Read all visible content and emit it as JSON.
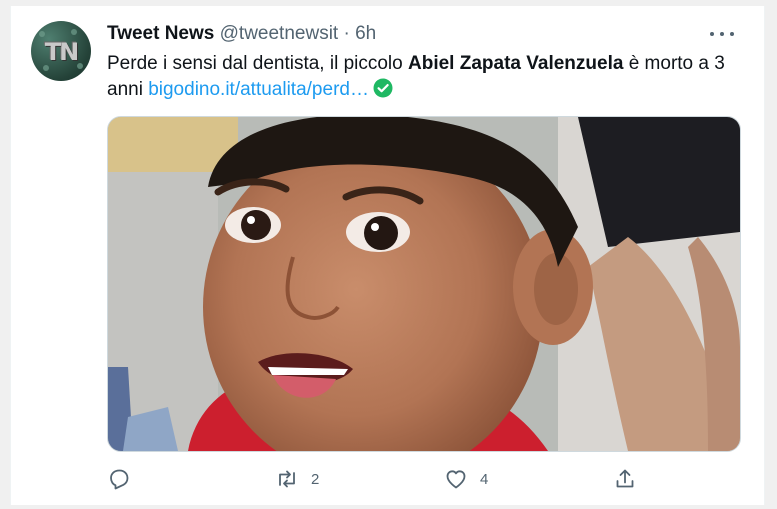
{
  "tweet": {
    "author_name": "Tweet News",
    "author_handle": "@tweetnewsit",
    "separator": "·",
    "time": "6h",
    "avatar_text": "TN",
    "text_part1": "Perde i sensi dal dentista, il piccolo ",
    "text_bold": "Abiel Zapata Valenzuela",
    "text_part2": " è morto a 3 anni ",
    "link": "bigodino.it/attualita/perd…",
    "check_icon": "green-check-circle-icon"
  },
  "actions": {
    "reply_count": "",
    "retweet_count": "2",
    "like_count": "4"
  },
  "colors": {
    "link": "#1d9bf0",
    "secondary_text": "#536471",
    "check_green": "#1fb863"
  }
}
